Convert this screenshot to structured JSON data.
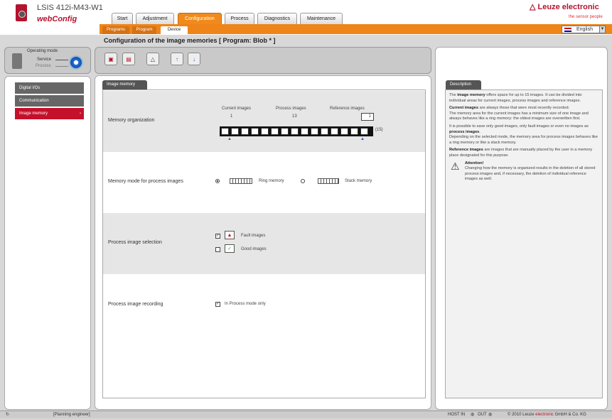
{
  "header": {
    "device_name": "LSIS 412i-M43-W1",
    "app_name": "webConfig",
    "brand": "Leuze electronic",
    "tagline": "the sensor people",
    "language": "English",
    "tabs": [
      {
        "label": "Start"
      },
      {
        "label": "Adjustment"
      },
      {
        "label": "Configuration",
        "active": true
      },
      {
        "label": "Process"
      },
      {
        "label": "Diagnostics"
      },
      {
        "label": "Maintenance"
      }
    ],
    "subtabs": [
      {
        "label": "Programs"
      },
      {
        "label": "Program"
      },
      {
        "label": "Device",
        "active": true
      }
    ]
  },
  "page_title": "Configuration of the image memories   [ Program: Blob * ]",
  "mode": {
    "title": "Operating mode",
    "service": "Service",
    "process": "Process"
  },
  "nav": [
    {
      "label": "Digital I/Os"
    },
    {
      "label": "Communication"
    },
    {
      "label": "Image memory",
      "active": true
    }
  ],
  "toolbar_icons": [
    "device-to-pc-icon",
    "pc-to-device-icon",
    "warning-icon",
    "upload-icon",
    "download-icon"
  ],
  "content": {
    "tab_label": "Image memory",
    "memory_org": {
      "label": "Memory organization",
      "current_label": "Current images",
      "process_label": "Process images",
      "reference_label": "Reference images",
      "current_value": "1",
      "process_value": "13",
      "reference_value": "1",
      "total": "(15)",
      "cells": 15
    },
    "memory_mode": {
      "label": "Memory mode for process images",
      "ring": "Ring memory",
      "stack": "Stack memory",
      "selected": "ring"
    },
    "selection": {
      "label": "Process image selection",
      "fault": "Fault images",
      "good": "Good images",
      "fault_checked": true,
      "good_checked": false
    },
    "recording": {
      "label": "Process image recording",
      "option": "In Process mode only",
      "checked": true
    }
  },
  "description": {
    "tab_label": "Description",
    "p1_a": "The ",
    "p1_b": "image memory",
    "p1_c": " offers space for up to 15 images. It can be divided into individual areas for current images, process images and reference images.",
    "p2_b": "Current images",
    "p2_c": " are always those that were most recently recorded.",
    "p3": "The memory area for the current images has a minimum size of one image and always behaves like a ring memory: the oldest images are overwritten first.",
    "p4_a": "It is possible to save only good images, only fault images or even no images as ",
    "p4_b": "process images",
    "p4_c": ".",
    "p5": "Depending on the selected mode, the memory area for process images behaves like a ring memory or like a stack memory.",
    "p6_b": "Reference images",
    "p6_c": " are images that are manually placed by the user in a memory place designated for this purpose.",
    "attention": "Attention!",
    "attention_text": "Changing how the memory is organized results in the deletion of all stored process images and, if necessary, the deletion of individual reference images as well."
  },
  "status": {
    "user": "[Planning engineer]",
    "host": "HOST IN",
    "out": "OUT",
    "copyright_a": "© 2010 Leuze ",
    "copyright_b": "electronic",
    "copyright_c": " GmbH & Co. KG"
  }
}
